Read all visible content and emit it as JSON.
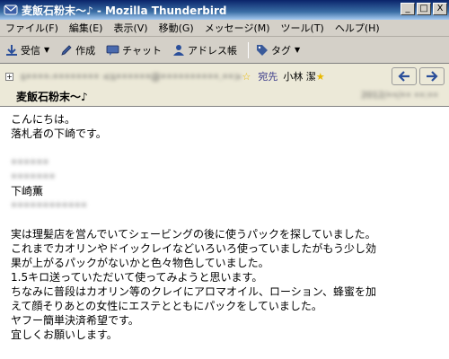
{
  "window": {
    "title": "麦飯石粉末～♪ - Mozilla Thunderbird",
    "controls": {
      "minimize": "_",
      "maximize": "□",
      "close": "X"
    }
  },
  "menubar": {
    "items": [
      "ファイル(F)",
      "編集(E)",
      "表示(V)",
      "移動(G)",
      "メッセージ(M)",
      "ツール(T)",
      "ヘルプ(H)"
    ]
  },
  "toolbar": {
    "receive_label": "受信",
    "compose_label": "作成",
    "chat_label": "チャット",
    "addressbook_label": "アドレス帳",
    "tag_label": "タグ"
  },
  "header": {
    "expand": "+",
    "from_blurred": "s••••-•••••••• <s••••••@••••••••••.••>",
    "to_label": "宛先",
    "to_name": "小林 潔",
    "subject": "麦飯石粉末～♪",
    "date_blurred": "2012/••/•• ••:••"
  },
  "body": {
    "greeting": "こんにちは。",
    "intro": "落札者の下崎です。",
    "blurred_1": "••••••",
    "blurred_2": "•••••••",
    "signature_name": "下崎薫",
    "blurred_3": "••••••••••••",
    "paragraph": [
      "実は理髪店を営んでいてシェービングの後に使うパックを探していました。",
      "これまでカオリンやドイックレイなどいろいろ使っていましたがもう少し効",
      "果が上がるパックがないかと色々物色していました。",
      "1.5キロ送っていただいて使ってみようと思います。",
      "ちなみに普段はカオリン等のクレイにアロマオイル、ローション、蜂蜜を加",
      "えて顔そりあとの女性にエステとともにパックをしていました。",
      "ヤフー簡単決済希望です。",
      "宜しくお願いします。"
    ]
  }
}
